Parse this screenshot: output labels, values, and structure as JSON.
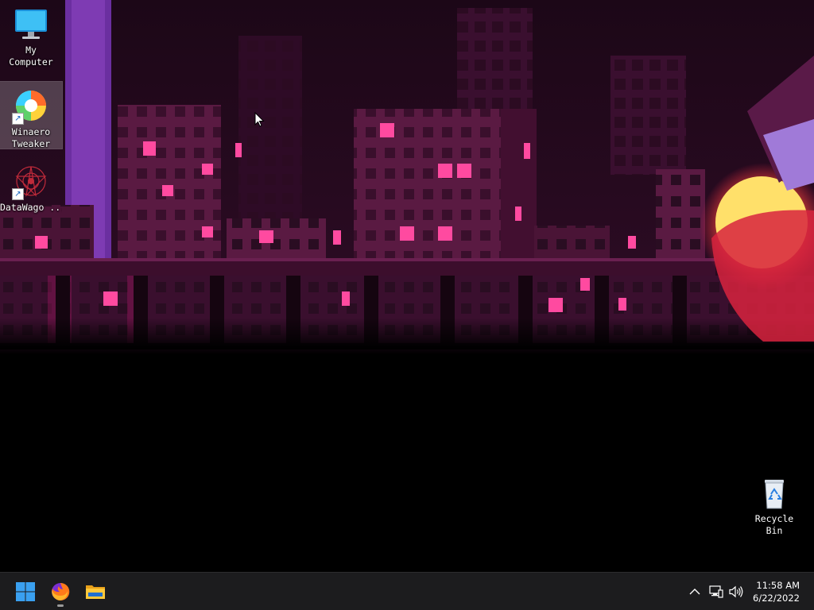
{
  "desktop": {
    "icons": [
      {
        "label": "My\nComputer",
        "icon": "monitor-icon"
      },
      {
        "label": "Winaero\nTweaker",
        "icon": "winaero-tweaker-icon",
        "shortcut": true,
        "selected": true
      },
      {
        "label": "DataWago ...",
        "icon": "datawago-icon",
        "shortcut": true
      },
      {
        "label": "Recycle\nBin",
        "icon": "recycle-bin-icon"
      }
    ],
    "shortcut_arrow": "↗"
  },
  "taskbar": {
    "pinned": [
      {
        "name": "start",
        "icon": "windows-logo-icon"
      },
      {
        "name": "firefox",
        "icon": "firefox-icon",
        "running": true
      },
      {
        "name": "file-explorer",
        "icon": "folder-icon"
      }
    ],
    "tray": {
      "chevron": "^",
      "icons": [
        "show-hidden-icons-chevron",
        "network-icon",
        "volume-icon"
      ]
    },
    "clock": {
      "time": "11:58 AM",
      "date": "6/22/2022"
    }
  },
  "colors": {
    "taskbar": "#1c1c1e",
    "accent_windows": "#3aa0f0",
    "wallpaper_dark": "#140611",
    "window_pink": "#ff4aa0"
  }
}
